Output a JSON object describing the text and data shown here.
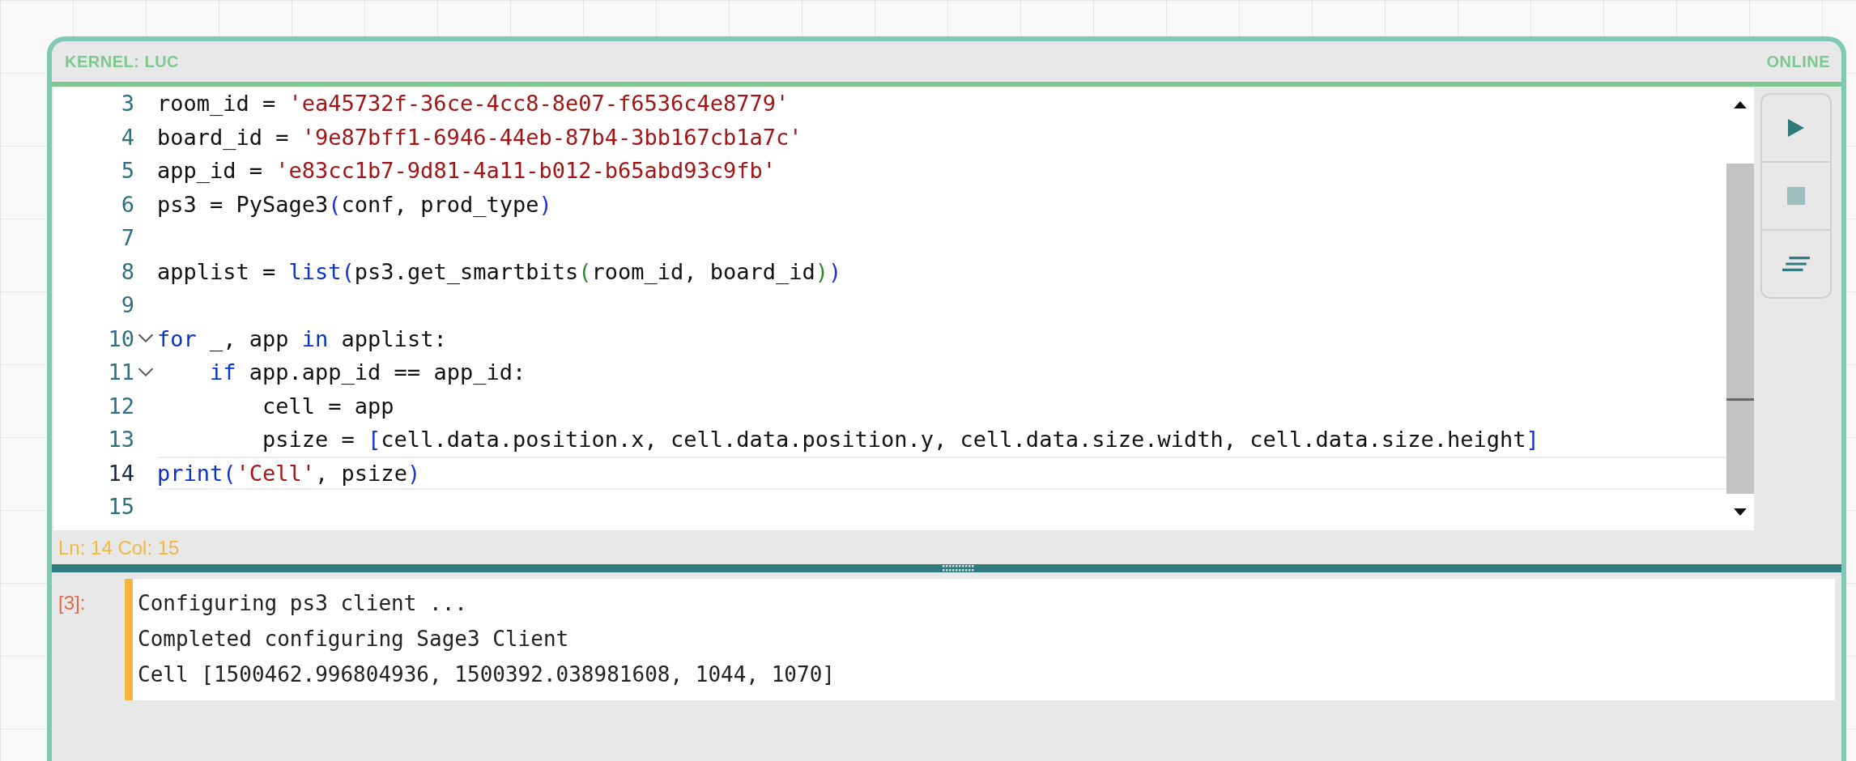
{
  "header": {
    "kernel": "KERNEL: LUC",
    "status": "ONLINE"
  },
  "editor": {
    "lines": [
      {
        "number": "3",
        "fold": false,
        "current": false,
        "tokens": [
          {
            "kind": "text",
            "text": "room_id = "
          },
          {
            "kind": "str",
            "text": "'ea45732f-36ce-4cc8-8e07-f6536c4e8779'"
          }
        ]
      },
      {
        "number": "4",
        "fold": false,
        "current": false,
        "tokens": [
          {
            "kind": "text",
            "text": "board_id = "
          },
          {
            "kind": "str",
            "text": "'9e87bff1-6946-44eb-87b4-3bb167cb1a7c'"
          }
        ]
      },
      {
        "number": "5",
        "fold": false,
        "current": false,
        "tokens": [
          {
            "kind": "text",
            "text": "app_id = "
          },
          {
            "kind": "str",
            "text": "'e83cc1b7-9d81-4a11-b012-b65abd93c9fb'"
          }
        ]
      },
      {
        "number": "6",
        "fold": false,
        "current": false,
        "tokens": [
          {
            "kind": "text",
            "text": "ps3 = PySage3"
          },
          {
            "kind": "bracket1",
            "text": "("
          },
          {
            "kind": "text",
            "text": "conf, prod_type"
          },
          {
            "kind": "bracket1",
            "text": ")"
          }
        ]
      },
      {
        "number": "7",
        "fold": false,
        "current": false
      },
      {
        "number": "8",
        "fold": false,
        "current": false,
        "tokens": [
          {
            "kind": "text",
            "text": "applist = "
          },
          {
            "kind": "kw",
            "text": "list"
          },
          {
            "kind": "bracket1",
            "text": "("
          },
          {
            "kind": "text",
            "text": "ps3.get_smartbits"
          },
          {
            "kind": "bracket2",
            "text": "("
          },
          {
            "kind": "text",
            "text": "room_id, board_id"
          },
          {
            "kind": "bracket2",
            "text": ")"
          },
          {
            "kind": "bracket1",
            "text": ")"
          }
        ]
      },
      {
        "number": "9",
        "fold": false,
        "current": false
      },
      {
        "number": "10",
        "fold": true,
        "current": false,
        "tokens": [
          {
            "kind": "kw",
            "text": "for"
          },
          {
            "kind": "text",
            "text": " _, app "
          },
          {
            "kind": "kw",
            "text": "in"
          },
          {
            "kind": "text",
            "text": " applist:"
          }
        ]
      },
      {
        "number": "11",
        "fold": true,
        "current": false,
        "tokens": [
          {
            "kind": "kw",
            "text": "    if"
          },
          {
            "kind": "text",
            "text": " app.app_id == app_id:"
          }
        ]
      },
      {
        "number": "12",
        "fold": false,
        "current": false,
        "tokens": [
          {
            "kind": "text",
            "text": "        cell = app"
          }
        ]
      },
      {
        "number": "13",
        "fold": false,
        "current": false,
        "tokens": [
          {
            "kind": "text",
            "text": "        psize = "
          },
          {
            "kind": "bracket1",
            "text": "["
          },
          {
            "kind": "text",
            "text": "cell.data.position.x, cell.data.position.y, cell.data.size.width, cell.data.size.height"
          },
          {
            "kind": "bracket1",
            "text": "]"
          }
        ]
      },
      {
        "number": "14",
        "fold": false,
        "current": true,
        "tokens": [
          {
            "kind": "kw",
            "text": "print"
          },
          {
            "kind": "bracket1",
            "text": "("
          },
          {
            "kind": "str",
            "text": "'Cell'"
          },
          {
            "kind": "text",
            "text": ", psize"
          },
          {
            "kind": "bracket1",
            "text": ")"
          }
        ]
      },
      {
        "number": "15",
        "fold": false,
        "current": false
      }
    ]
  },
  "cursor_status": "Ln: 14 Col: 15",
  "output": {
    "prompt": "[3]:",
    "lines": [
      "Configuring ps3 client ...",
      "Completed configuring Sage3 Client",
      "Cell [1500462.996804936, 1500392.038981608, 1044, 1070]"
    ]
  }
}
